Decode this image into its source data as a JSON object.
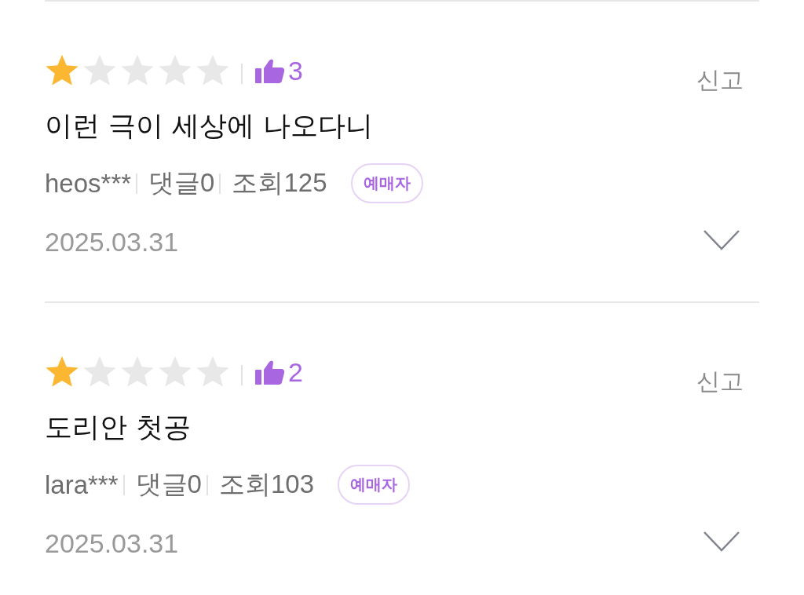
{
  "reviews": [
    {
      "stars": 1,
      "likes": "3",
      "report": "신고",
      "title": "이런 극이 세상에 나오다니",
      "user": "heos***",
      "comments": "댓글0",
      "views": "조회125",
      "badge": "예매자",
      "date": "2025.03.31",
      "expanded": false
    },
    {
      "stars": 1,
      "likes": "2",
      "report": "신고",
      "title": "도리안 첫공",
      "user": "lara***",
      "comments": "댓글0",
      "views": "조회103",
      "badge": "예매자",
      "date": "2025.03.31",
      "expanded": false
    }
  ]
}
